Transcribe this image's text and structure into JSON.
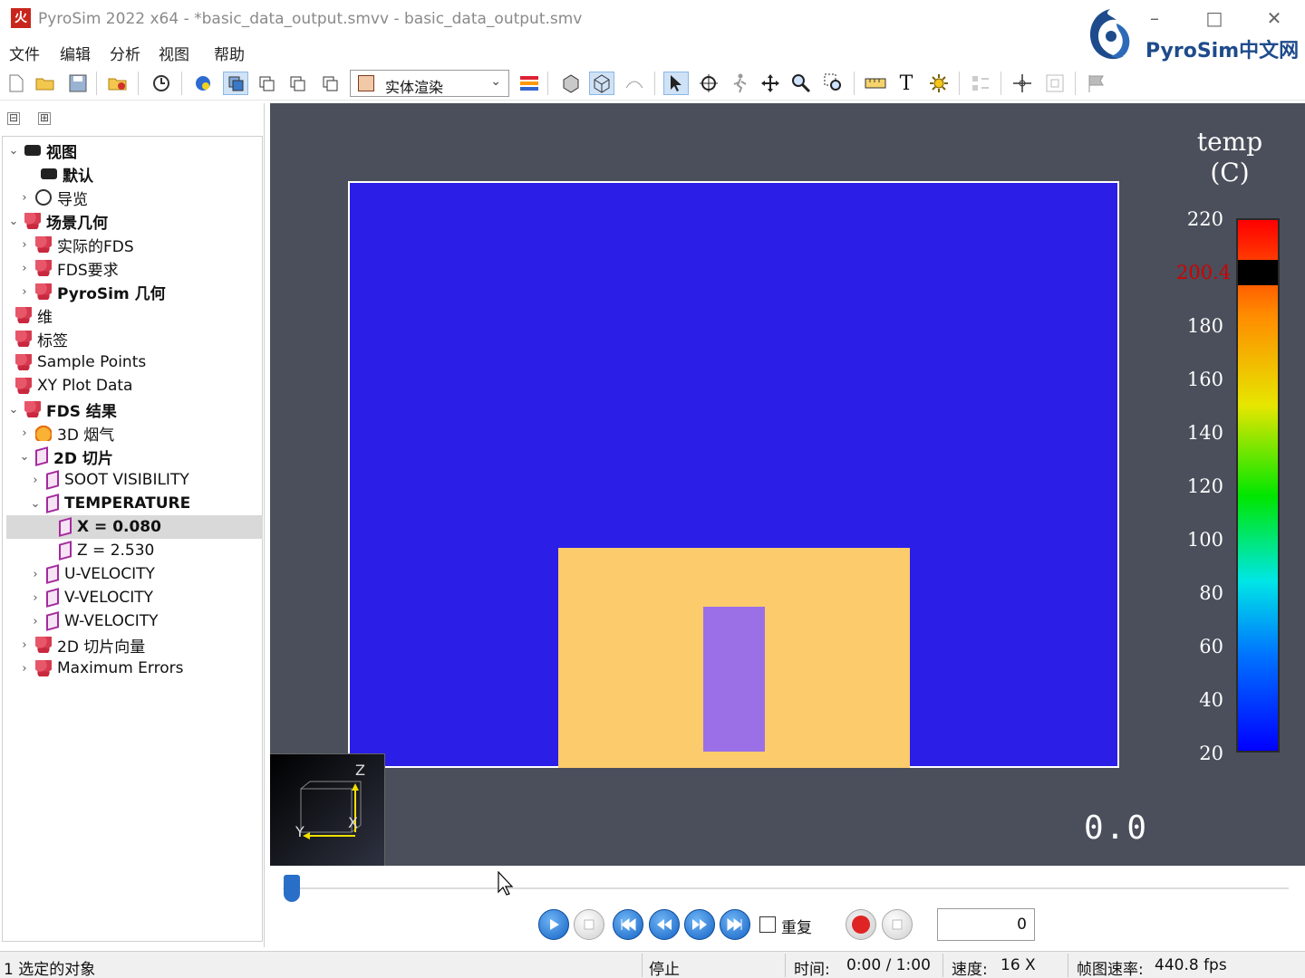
{
  "window": {
    "title": "PyroSim 2022 x64 - *basic_data_output.smvv - basic_data_output.smv",
    "app_icon_glyph": "火",
    "brand": "PyroSim中文网",
    "minimize": "–",
    "maximize": "□",
    "close": "✕"
  },
  "menu": {
    "file": "文件",
    "edit": "编辑",
    "analyze": "分析",
    "view": "视图",
    "help": "帮助"
  },
  "toolbar": {
    "render_mode": "实体渲染",
    "icons": [
      "new-file-icon",
      "open-folder-icon",
      "save-icon",
      "import-icon",
      "clock-icon",
      "globe-icon",
      "view-front-icon",
      "view-side-icon",
      "view-top-icon",
      "view-iso-icon",
      "color-bars-icon",
      "solid-box-icon",
      "wire-box-icon",
      "smooth-icon",
      "select-arrow-icon",
      "orbit-icon",
      "walk-icon",
      "pan-icon",
      "zoom-icon",
      "zoom-region-icon",
      "ruler-icon",
      "text-icon",
      "light-icon",
      "align-icon",
      "center-icon",
      "fit-icon",
      "flag-icon"
    ]
  },
  "tree": {
    "collapse_all": "⊟",
    "expand_all": "⊞",
    "nodes": [
      {
        "label": "视图",
        "icon": "camera-icon"
      },
      {
        "label": "默认",
        "icon": "camera-icon"
      },
      {
        "label": "导览",
        "icon": "navigation-icon"
      },
      {
        "label": "场景几何",
        "icon": "geometry-icon"
      },
      {
        "label": "实际的FDS",
        "icon": "geometry-icon"
      },
      {
        "label": "FDS要求",
        "icon": "geometry-icon"
      },
      {
        "label": "PyroSim 几何",
        "icon": "geometry-icon"
      },
      {
        "label": "维",
        "icon": "geometry-icon"
      },
      {
        "label": "标签",
        "icon": "geometry-icon"
      },
      {
        "label": "Sample Points",
        "icon": "geometry-icon"
      },
      {
        "label": "XY Plot Data",
        "icon": "geometry-icon"
      },
      {
        "label": "FDS 结果",
        "icon": "geometry-icon"
      },
      {
        "label": "3D 烟气",
        "icon": "smoke-icon"
      },
      {
        "label": "2D 切片",
        "icon": "slice-icon"
      },
      {
        "label": "SOOT VISIBILITY",
        "icon": "slice-icon"
      },
      {
        "label": "TEMPERATURE",
        "icon": "slice-icon"
      },
      {
        "label": "X = 0.080",
        "icon": "slice-icon"
      },
      {
        "label": "Z = 2.530",
        "icon": "slice-icon"
      },
      {
        "label": "U-VELOCITY",
        "icon": "slice-icon"
      },
      {
        "label": "V-VELOCITY",
        "icon": "slice-icon"
      },
      {
        "label": "W-VELOCITY",
        "icon": "slice-icon"
      },
      {
        "label": "2D 切片向量",
        "icon": "geometry-icon"
      },
      {
        "label": "Maximum Errors",
        "icon": "geometry-icon"
      }
    ],
    "selected": "X = 0.080"
  },
  "viewport": {
    "colorbar": {
      "title": "temp\n(C)",
      "ticks": [
        "220",
        "200.4",
        "180",
        "160",
        "140",
        "120",
        "100",
        "80",
        "60",
        "40",
        "20"
      ],
      "highlight_value": "200.4",
      "colors": {
        "background": "#4a4f5b",
        "scene": "#2b1ee6",
        "hot_region": "#fccb6b",
        "core": "#9b70e6"
      }
    },
    "time": "0.0",
    "axes": {
      "z": "Z",
      "y": "Y",
      "x": "X"
    }
  },
  "playback": {
    "repeat_label": "重复",
    "repeat_checked": false,
    "frame": "0",
    "progress_fraction": 0.0
  },
  "status": {
    "selection": "1 选定的对象",
    "state": "停止",
    "time_label": "时间:",
    "time_value": "0:00 / 1:00",
    "speed_label": "速度:",
    "speed_value": "16 X",
    "fps_label": "帧图速率:",
    "fps_value": "440.8 fps"
  }
}
